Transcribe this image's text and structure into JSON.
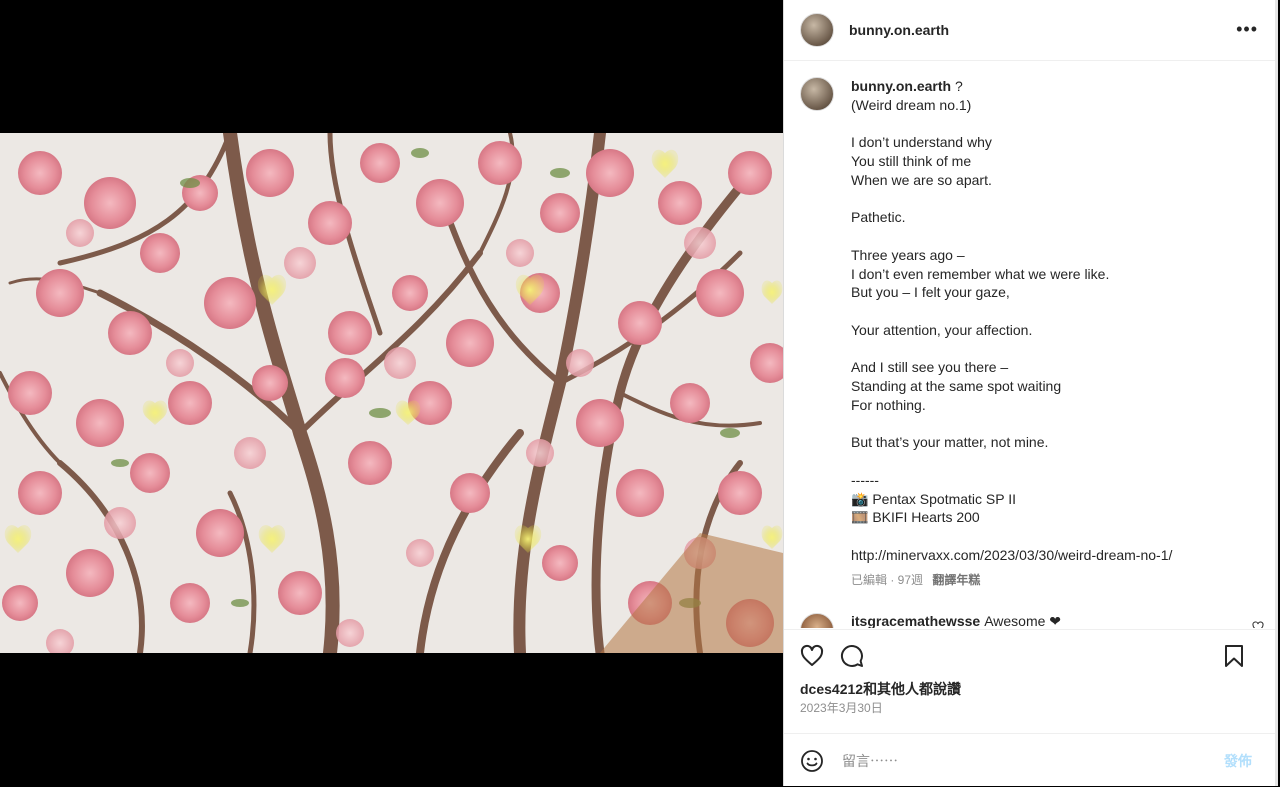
{
  "post": {
    "username": "bunny.on.earth",
    "more_icon": "more-horizontal-icon",
    "image_alt": "pink cherry blossom tree branches"
  },
  "caption": {
    "username": "bunny.on.earth",
    "lines": [
      " ?",
      "(Weird dream no.1)",
      "",
      "I don’t understand why",
      "You still think of me",
      "When we are so apart.",
      "",
      "Pathetic.",
      "",
      "Three years ago –",
      "I don’t even remember what we were like.",
      "But you – I felt your gaze,",
      "",
      "Your attention, your affection.",
      "",
      "And I still see you there –",
      "Standing at the same spot waiting",
      "For nothing.",
      "",
      "But that’s your matter, not mine.",
      "",
      "------",
      "📸 Pentax Spotmatic SP II",
      "🎞️ BKIFI Hearts 200",
      "",
      "http://minervaxx.com/2023/03/30/weird-dream-no-1/"
    ],
    "meta": "已編輯 · 97週",
    "translate": "翻譯年糕"
  },
  "comments": [
    {
      "username": "itsgracemathewsse",
      "text": "Awesome ❤"
    }
  ],
  "actions": {
    "like_icon": "heart-icon",
    "comment_icon": "comment-icon",
    "save_icon": "bookmark-icon"
  },
  "likes": {
    "user": "dces4212",
    "rest": "和其他人都說讚"
  },
  "date": "2023年3月30日",
  "comment_box": {
    "placeholder": "留言⋯⋯",
    "post_label": "發佈",
    "emoji_icon": "emoji-icon"
  },
  "colors": {
    "accent": "#0095f6",
    "post_disabled": "#b2dffc",
    "text": "#262626",
    "muted": "#8e8e8e"
  }
}
